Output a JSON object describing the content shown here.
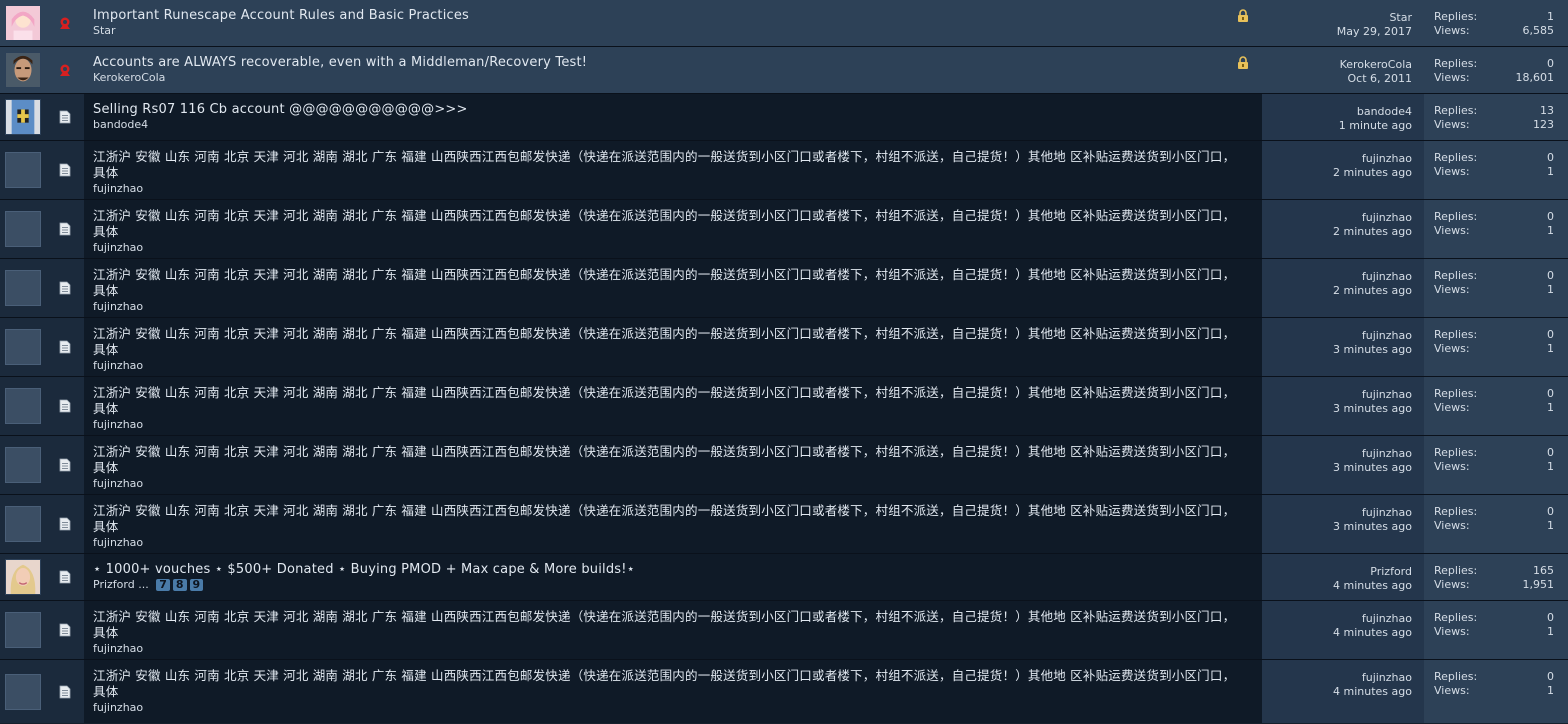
{
  "labels": {
    "replies": "Replies:",
    "views": "Views:",
    "ellipsis": "..."
  },
  "colors": {
    "row_dark": "#0f1a27",
    "row_sticky": "#2d4157",
    "accent": "#4a7ba8"
  },
  "threads": [
    {
      "title": "Important Runescape Account Rules and Basic Practices",
      "author": "Star",
      "last_user": "Star",
      "last_time": "May 29, 2017",
      "replies": "1",
      "views": "6,585",
      "sticky": true,
      "locked": true,
      "icon": "pin-icon",
      "avatar": "anime-girl-avatar"
    },
    {
      "title": "Accounts are ALWAYS recoverable, even with a Middleman/Recovery Test!",
      "author": "KerokeroCola",
      "last_user": "KerokeroCola",
      "last_time": "Oct 6, 2011",
      "replies": "0",
      "views": "18,601",
      "sticky": true,
      "locked": true,
      "icon": "pin-icon",
      "avatar": "man-face-avatar"
    },
    {
      "title": "Selling Rs07 116 Cb account @@@@@@@@@@@>>>",
      "author": "bandode4",
      "last_user": "bandode4",
      "last_time": "1 minute ago",
      "replies": "13",
      "views": "123",
      "icon": "document-icon",
      "avatar": "knight-avatar"
    },
    {
      "title": "江浙沪 安徽 山东 河南 北京 天津 河北 湖南 湖北 广东 福建 山西陕西江西包邮发快递（快递在派送范围内的一般送货到小区门口或者楼下，村组不派送，自己提货！）其他地 区补贴运费送货到小区门口，具体",
      "author": "fujinzhao",
      "last_user": "fujinzhao",
      "last_time": "2 minutes ago",
      "replies": "0",
      "views": "1",
      "icon": "document-icon",
      "avatar": "default-avatar"
    },
    {
      "title": "江浙沪 安徽 山东 河南 北京 天津 河北 湖南 湖北 广东 福建 山西陕西江西包邮发快递（快递在派送范围内的一般送货到小区门口或者楼下，村组不派送，自己提货！）其他地 区补贴运费送货到小区门口，具体",
      "author": "fujinzhao",
      "last_user": "fujinzhao",
      "last_time": "2 minutes ago",
      "replies": "0",
      "views": "1",
      "icon": "document-icon",
      "avatar": "default-avatar"
    },
    {
      "title": "江浙沪 安徽 山东 河南 北京 天津 河北 湖南 湖北 广东 福建 山西陕西江西包邮发快递（快递在派送范围内的一般送货到小区门口或者楼下，村组不派送，自己提货！）其他地 区补贴运费送货到小区门口，具体",
      "author": "fujinzhao",
      "last_user": "fujinzhao",
      "last_time": "2 minutes ago",
      "replies": "0",
      "views": "1",
      "icon": "document-icon",
      "avatar": "default-avatar"
    },
    {
      "title": "江浙沪 安徽 山东 河南 北京 天津 河北 湖南 湖北 广东 福建 山西陕西江西包邮发快递（快递在派送范围内的一般送货到小区门口或者楼下，村组不派送，自己提货！）其他地 区补贴运费送货到小区门口，具体",
      "author": "fujinzhao",
      "last_user": "fujinzhao",
      "last_time": "3 minutes ago",
      "replies": "0",
      "views": "1",
      "icon": "document-icon",
      "avatar": "default-avatar"
    },
    {
      "title": "江浙沪 安徽 山东 河南 北京 天津 河北 湖南 湖北 广东 福建 山西陕西江西包邮发快递（快递在派送范围内的一般送货到小区门口或者楼下，村组不派送，自己提货！）其他地 区补贴运费送货到小区门口，具体",
      "author": "fujinzhao",
      "last_user": "fujinzhao",
      "last_time": "3 minutes ago",
      "replies": "0",
      "views": "1",
      "icon": "document-icon",
      "avatar": "default-avatar"
    },
    {
      "title": "江浙沪 安徽 山东 河南 北京 天津 河北 湖南 湖北 广东 福建 山西陕西江西包邮发快递（快递在派送范围内的一般送货到小区门口或者楼下，村组不派送，自己提货！）其他地 区补贴运费送货到小区门口，具体",
      "author": "fujinzhao",
      "last_user": "fujinzhao",
      "last_time": "3 minutes ago",
      "replies": "0",
      "views": "1",
      "icon": "document-icon",
      "avatar": "default-avatar"
    },
    {
      "title": "江浙沪 安徽 山东 河南 北京 天津 河北 湖南 湖北 广东 福建 山西陕西江西包邮发快递（快递在派送范围内的一般送货到小区门口或者楼下，村组不派送，自己提货！）其他地 区补贴运费送货到小区门口，具体",
      "author": "fujinzhao",
      "last_user": "fujinzhao",
      "last_time": "3 minutes ago",
      "replies": "0",
      "views": "1",
      "icon": "document-icon",
      "avatar": "default-avatar"
    },
    {
      "title": "⋆ 1000+ vouches ⋆ $500+ Donated ⋆ Buying PMOD + Max cape & More builds!⋆",
      "author": "Prizford",
      "last_user": "Prizford",
      "last_time": "4 minutes ago",
      "replies": "165",
      "views": "1,951",
      "icon": "document-icon",
      "avatar": "blonde-avatar",
      "pages": [
        "7",
        "8",
        "9"
      ]
    },
    {
      "title": "江浙沪 安徽 山东 河南 北京 天津 河北 湖南 湖北 广东 福建 山西陕西江西包邮发快递（快递在派送范围内的一般送货到小区门口或者楼下，村组不派送，自己提货！）其他地 区补贴运费送货到小区门口，具体",
      "author": "fujinzhao",
      "last_user": "fujinzhao",
      "last_time": "4 minutes ago",
      "replies": "0",
      "views": "1",
      "icon": "document-icon",
      "avatar": "default-avatar"
    },
    {
      "title": "江浙沪 安徽 山东 河南 北京 天津 河北 湖南 湖北 广东 福建 山西陕西江西包邮发快递（快递在派送范围内的一般送货到小区门口或者楼下，村组不派送，自己提货！）其他地 区补贴运费送货到小区门口，具体",
      "author": "fujinzhao",
      "last_user": "fujinzhao",
      "last_time": "4 minutes ago",
      "replies": "0",
      "views": "1",
      "icon": "document-icon",
      "avatar": "default-avatar"
    }
  ]
}
